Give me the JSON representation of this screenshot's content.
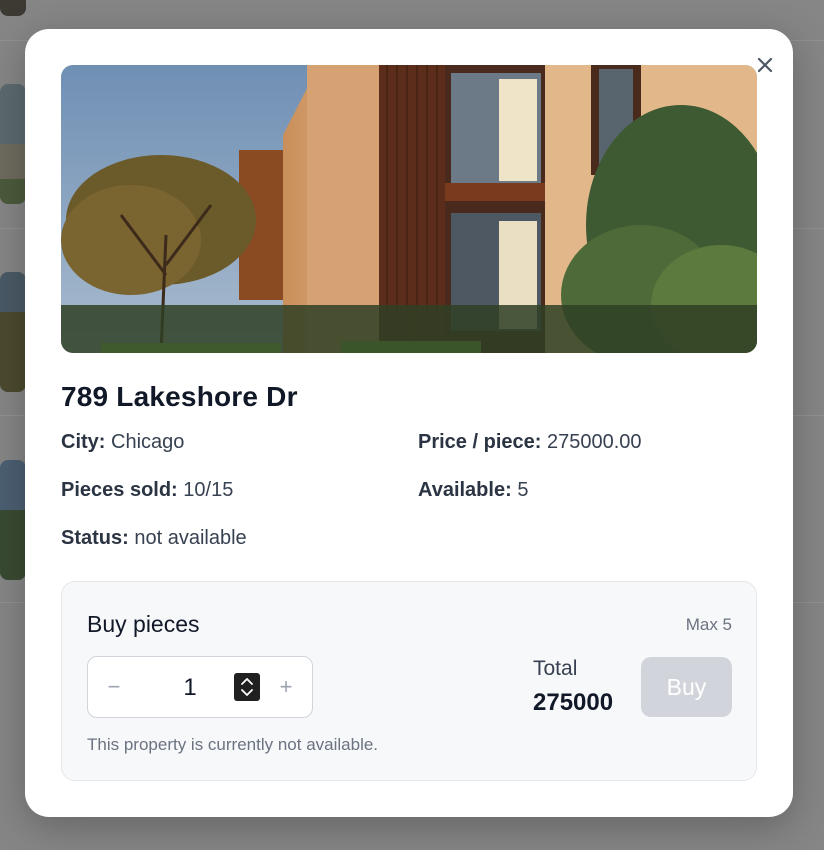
{
  "modal": {
    "title": "789 Lakeshore Dr",
    "close_icon": "close-icon",
    "hero_image": "modern-house-photo",
    "facts": {
      "city_label": "City:",
      "city_value": "Chicago",
      "price_label": "Price / piece:",
      "price_value": "275000.00",
      "sold_label": "Pieces sold:",
      "sold_value": "10/15",
      "available_label": "Available:",
      "available_value": "5",
      "status_label": "Status:",
      "status_value": "not available"
    },
    "buy": {
      "title": "Buy pieces",
      "max": "Max 5",
      "minus_label": "−",
      "plus_label": "+",
      "quantity": "1",
      "total_label": "Total",
      "total_value": "275000",
      "buy_label": "Buy",
      "notice": "This property is currently not available."
    }
  },
  "colors": {
    "overlay": "#868686",
    "modal_bg": "#ffffff",
    "buy_box_bg": "#f7f8fa",
    "disabled_button": "#d1d5db",
    "title_text": "#111827",
    "muted_text": "#6b7280"
  }
}
